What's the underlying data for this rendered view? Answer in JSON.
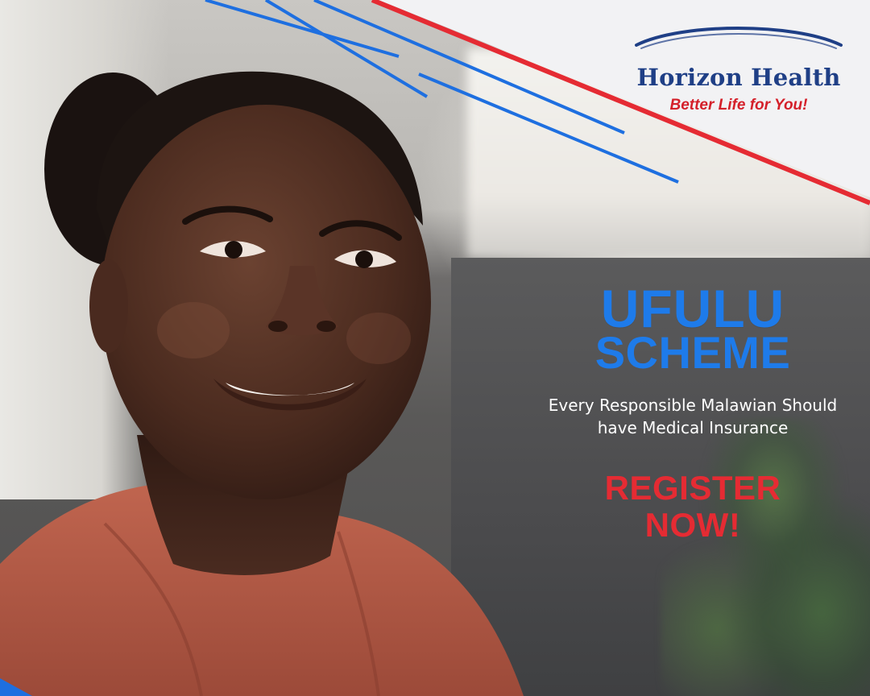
{
  "brand": {
    "name": "Horizon Health",
    "tagline": "Better Life for You!",
    "colors": {
      "navy": "#1f3f86",
      "blue": "#1e7bea",
      "red": "#e52b33",
      "white": "#ffffff"
    }
  },
  "promo": {
    "headline_line1": "UFULU",
    "headline_line2": "SCHEME",
    "message": "Every Responsible Malawian Should have Medical Insurance",
    "cta_line1": "REGISTER",
    "cta_line2": "NOW!"
  }
}
